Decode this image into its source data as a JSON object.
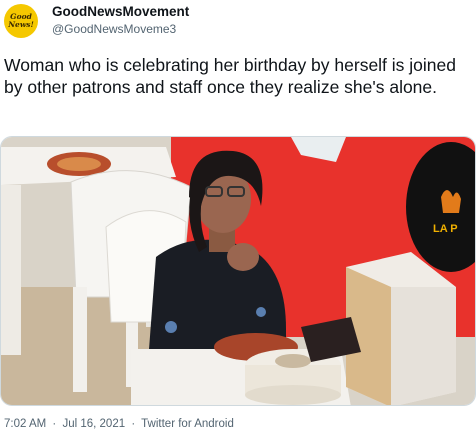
{
  "account": {
    "avatar_line1": "Good",
    "avatar_line2": "News!",
    "display_name": "GoodNewsMovement",
    "handle": "@GoodNewsMoveme3"
  },
  "tweet": {
    "text": "Woman who is celebrating her birthday by herself is joined by other patrons and staff once they realize she's alone."
  },
  "media": {
    "description_icon": "video-frame",
    "wall_sign_text": "LA P"
  },
  "footer": {
    "time": "7:02 AM",
    "separator": "·",
    "date": "Jul 16, 2021",
    "client": "Twitter for Android"
  },
  "colors": {
    "avatar_bg": "#f5c800",
    "text_primary": "#0f1419",
    "text_secondary": "#536471",
    "wall_red": "#e8322c"
  }
}
